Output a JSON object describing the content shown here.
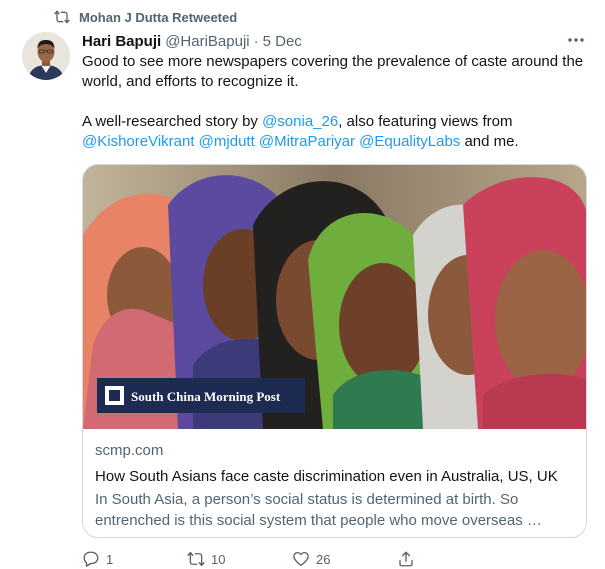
{
  "retweet_banner": {
    "text": "Mohan J Dutta Retweeted",
    "icon": "retweet-icon"
  },
  "tweet": {
    "author_name": "Hari Bapuji",
    "author_handle": "@HariBapuji",
    "separator": "·",
    "date": "5 Dec",
    "more_icon": "more-icon",
    "paragraph1": "Good to see more newspapers covering the prevalence of caste around the world, and efforts to recognize it.",
    "para2_prefix": "A well-researched story by ",
    "mentions": [
      "@sonia_26",
      "@KishoreVikrant",
      "@mjdutt",
      "@MitraPariyar",
      "@EqualityLabs"
    ],
    "para2_mid": ", also featuring views from",
    "para2_suffix": " and me.",
    "space": " "
  },
  "card": {
    "logo_text": "South China Morning Post",
    "domain": "scmp.com",
    "title": "How South Asians face caste discrimination even in Australia, US, UK",
    "description": "In South Asia, a person’s social status is determined at birth. So entrenched is this social system that people who move overseas …"
  },
  "actions": [
    {
      "icon": "reply-icon",
      "count": "1"
    },
    {
      "icon": "retweet-icon",
      "count": "10"
    },
    {
      "icon": "like-icon",
      "count": "26"
    },
    {
      "icon": "share-icon",
      "count": ""
    }
  ],
  "colors": {
    "link": "#1d9bf0",
    "secondary_text": "#536471",
    "primary_text": "#0f1419",
    "card_border": "#cfd9de",
    "logo_bg": "#1d2a52"
  }
}
